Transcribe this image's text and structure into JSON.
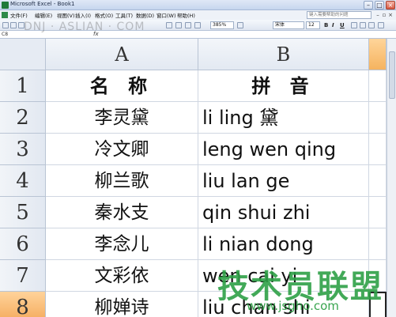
{
  "window": {
    "title": "Microsoft Excel - Book1"
  },
  "menu": {
    "items": [
      "文件(F)",
      "编辑(E)",
      "视图(V)",
      "插入(I)",
      "格式(O)",
      "工具(T)",
      "数据(D)",
      "窗口(W)",
      "帮助(H)"
    ],
    "help_placeholder": "键入需要帮助的问题"
  },
  "toolbar": {
    "zoom": "385%",
    "font": "宋体",
    "size": "12",
    "bold": "B",
    "italic": "I",
    "underline": "U"
  },
  "formula_bar": {
    "name_box": "C8",
    "fx": "fx"
  },
  "columns": [
    "A",
    "B"
  ],
  "rows": [
    {
      "num": "1",
      "name": "名 称",
      "pinyin": "拼 音"
    },
    {
      "num": "2",
      "name": "李灵黛",
      "pinyin": "li ling 黛"
    },
    {
      "num": "3",
      "name": "冷文卿",
      "pinyin": "leng wen qing"
    },
    {
      "num": "4",
      "name": "柳兰歌",
      "pinyin": "liu lan ge"
    },
    {
      "num": "5",
      "name": "秦水支",
      "pinyin": "qin shui zhi"
    },
    {
      "num": "6",
      "name": "李念儿",
      "pinyin": "li nian dong"
    },
    {
      "num": "7",
      "name": "文彩依",
      "pinyin": "wen cai yi"
    },
    {
      "num": "8",
      "name": "柳婵诗",
      "pinyin": "liu chan shi"
    }
  ],
  "watermarks": {
    "top": "DNJ · ASLIAN · COM",
    "logo": "技术员联盟",
    "url": "www.jsgho.com"
  }
}
